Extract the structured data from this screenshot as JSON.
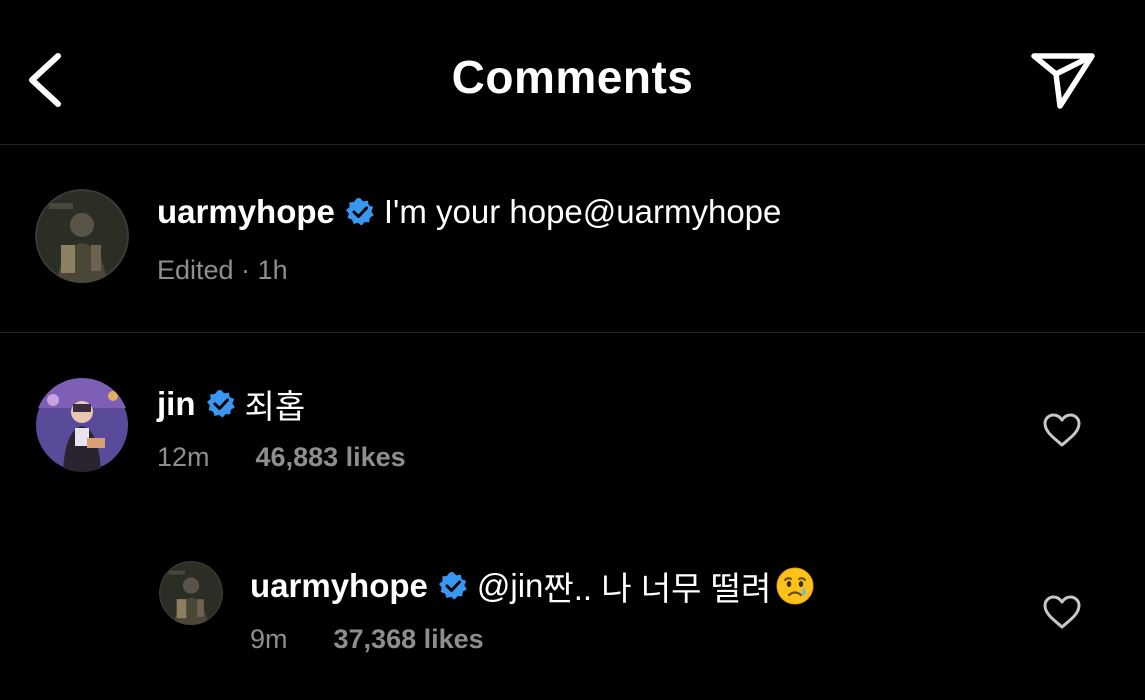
{
  "header": {
    "title": "Comments"
  },
  "caption": {
    "username": "uarmyhope",
    "text": "I'm your hope ",
    "mention": "@uarmyhope",
    "meta": "Edited · 1h"
  },
  "comments": [
    {
      "username": "jin",
      "text": "죄홉",
      "time": "12m",
      "likes": "46,883 likes"
    },
    {
      "username": "uarmyhope",
      "mention": "@jin",
      "text": " 짠.. 나 너무 떨려",
      "emoji": "crying-face-emoji",
      "time": "9m",
      "likes": "37,368 likes"
    }
  ],
  "icons": {
    "back": "chevron-left-icon",
    "share": "paper-plane-icon",
    "verified": "verified-badge-icon",
    "heart": "heart-outline-icon"
  },
  "colors": {
    "background": "#000000",
    "text": "#ffffff",
    "secondary_text": "#8e8e8e",
    "verified_blue": "#3897f0",
    "divider": "#262626"
  }
}
